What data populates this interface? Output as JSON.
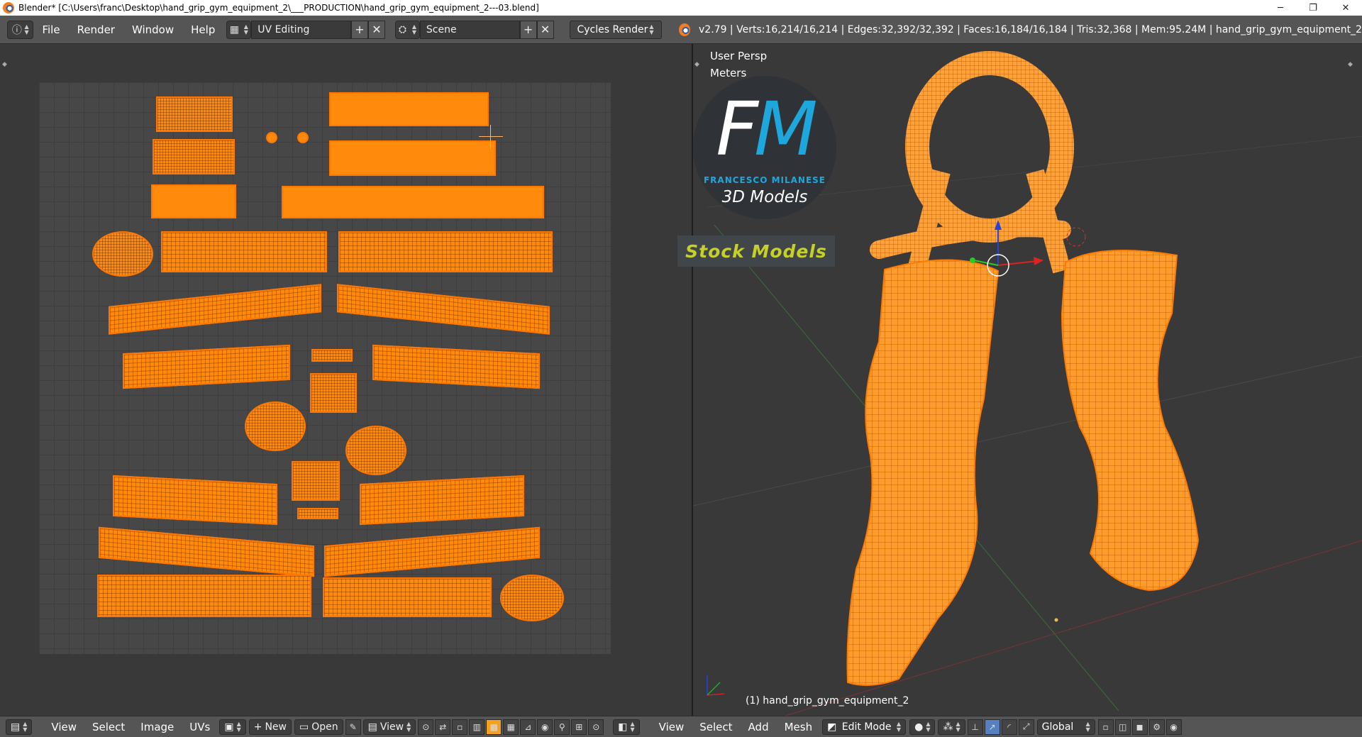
{
  "window": {
    "title": "Blender* [C:\\Users\\franc\\Desktop\\hand_grip_gym_equipment_2\\___PRODUCTION\\hand_grip_gym_equipment_2---03.blend]",
    "minimize": "─",
    "restore": "❐",
    "close": "✕"
  },
  "menu": {
    "file": "File",
    "render": "Render",
    "window": "Window",
    "help": "Help"
  },
  "screen_layout": "UV Editing",
  "scene": "Scene",
  "render_engine": "Cycles Render",
  "stats": "v2.79 | Verts:16,214/16,214 | Edges:32,392/32,392 | Faces:16,184/16,184 | Tris:32,368 | Mem:95.24M | hand_grip_gym_equipment_2",
  "viewport": {
    "view_name": "User Persp",
    "units": "Meters",
    "object_label": "(1) hand_grip_gym_equipment_2"
  },
  "logo": {
    "letter_f": "F",
    "letter_m": "M",
    "name": "FRANCESCO MILANESE",
    "subtitle": "3D Models",
    "band": "Stock Models"
  },
  "uv_header": {
    "view": "View",
    "select": "Select",
    "image": "Image",
    "uvs": "UVs",
    "new": "New",
    "open": "Open",
    "view2": "View"
  },
  "view3d_header": {
    "view": "View",
    "select": "Select",
    "add": "Add",
    "mesh": "Mesh",
    "mode": "Edit Mode",
    "orientation": "Global"
  },
  "colors": {
    "mesh_orange": "#ff8a0c",
    "logo_blue": "#1ea7dd",
    "logo_band_text": "#c5d028",
    "background": "#393939"
  }
}
